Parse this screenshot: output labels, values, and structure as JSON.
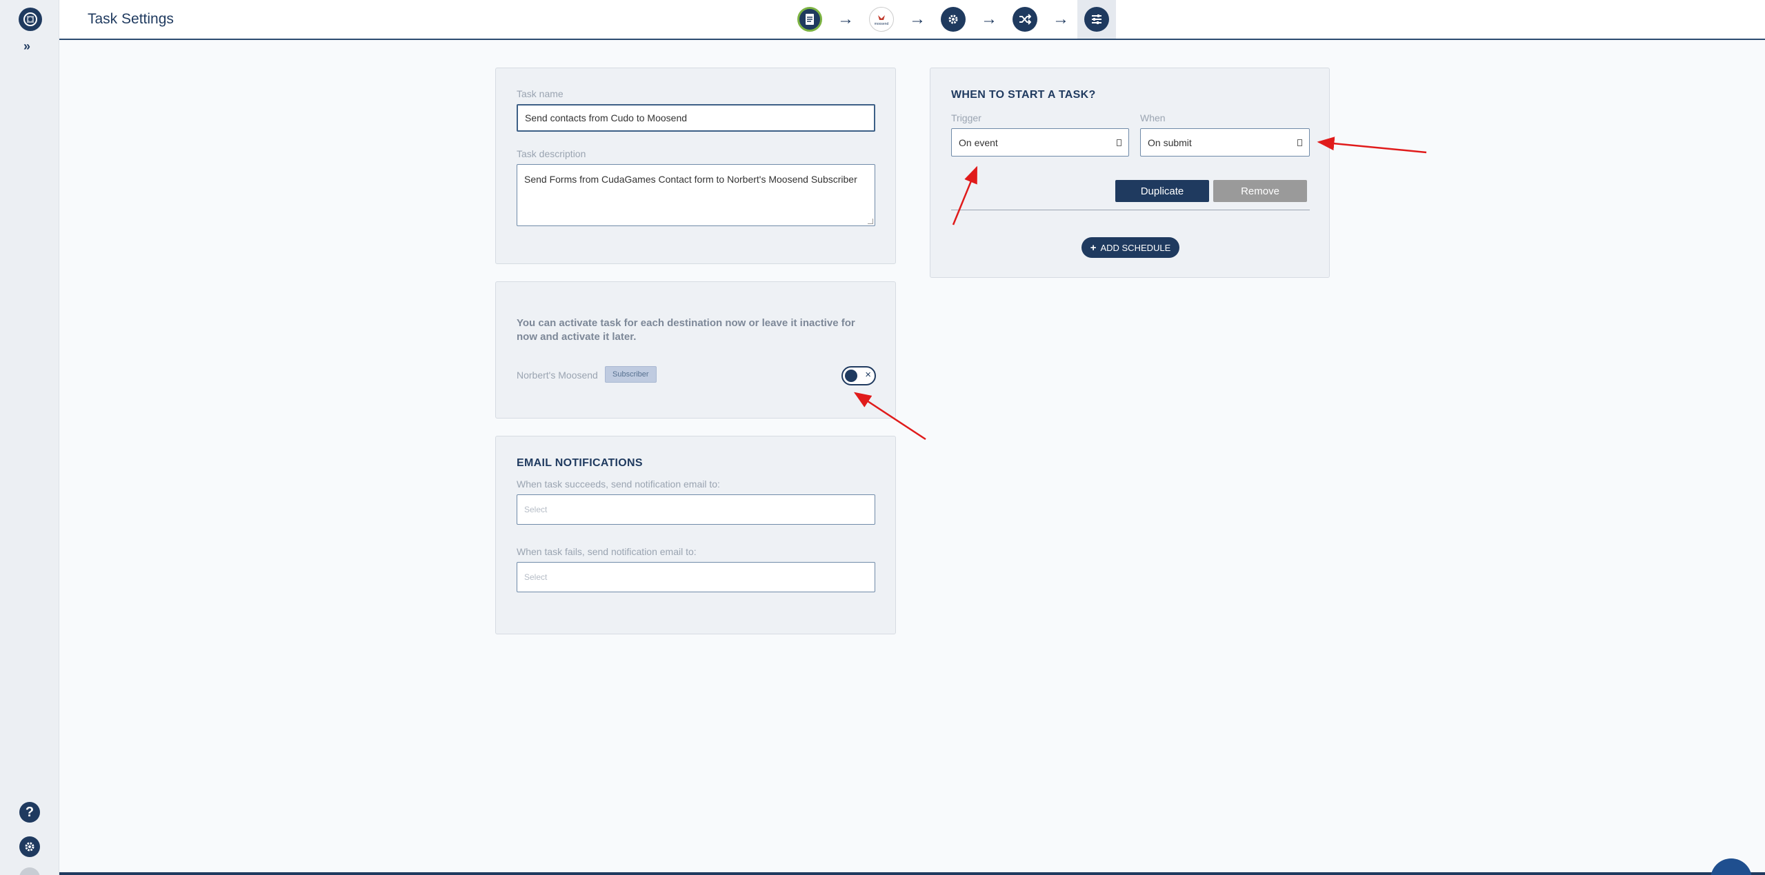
{
  "page": {
    "title": "Task Settings"
  },
  "sidebar": {
    "expand_icon": "double-chevron-right-icon",
    "help_icon": "question-icon",
    "settings_icon": "gear-icon"
  },
  "steps": [
    {
      "name": "cudagames-source",
      "icon": "form-icon"
    },
    {
      "name": "moosend-destination",
      "icon": "moosend-logo",
      "label": "moosend"
    },
    {
      "name": "settings-step",
      "icon": "gear-icon"
    },
    {
      "name": "mapping-step",
      "icon": "shuffle-icon"
    },
    {
      "name": "task-settings-step",
      "icon": "sliders-icon"
    }
  ],
  "task": {
    "name_label": "Task name",
    "name_value": "Send contacts from Cudo to Moosend",
    "description_label": "Task description",
    "description_value": "Send Forms from CudaGames Contact form to Norbert's Moosend Subscriber"
  },
  "activation": {
    "info": "You can activate task for each destination now or leave it inactive for now and activate it later.",
    "destination_name": "Norbert's Moosend",
    "destination_badge": "Subscriber"
  },
  "notifications": {
    "heading": "EMAIL NOTIFICATIONS",
    "success_label": "When task succeeds, send notification email to:",
    "success_placeholder": "Select",
    "fail_label": "When task fails, send notification email to:",
    "fail_placeholder": "Select"
  },
  "schedule": {
    "heading": "WHEN TO START A TASK?",
    "trigger_label": "Trigger",
    "trigger_value": "On event",
    "when_label": "When",
    "when_value": "On submit",
    "duplicate_label": "Duplicate",
    "remove_label": "Remove",
    "add_schedule_label": "ADD SCHEDULE"
  },
  "colors": {
    "primary": "#1f3a5f",
    "annotation": "#e01b1b"
  }
}
